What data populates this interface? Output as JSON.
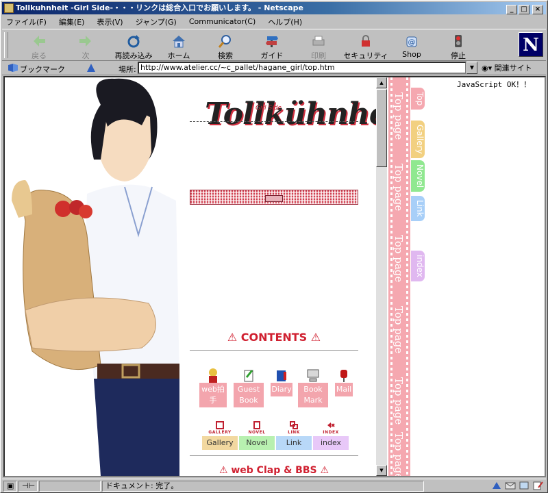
{
  "window": {
    "title": "Tollkuhnheit -Girl Side-・・・リンクは総合入口でお願いします。 - Netscape",
    "minimize": "_",
    "maximize": "□",
    "close": "×"
  },
  "menu": [
    "ファイル(F)",
    "編集(E)",
    "表示(V)",
    "ジャンプ(G)",
    "Communicator(C)",
    "ヘルプ(H)"
  ],
  "toolbar": {
    "back": "戻る",
    "forward": "次",
    "reload": "再読み込み",
    "home": "ホーム",
    "search": "検索",
    "guide": "ガイド",
    "print": "印刷",
    "security": "セキュリティ",
    "shop": "Shop",
    "stop": "停止",
    "logo": "N"
  },
  "location": {
    "bookmarks": "ブックマーク",
    "label": "場所:",
    "url": "http://www.atelier.cc/~c_pallet/hagane_girl/top.htm",
    "related": "関連サイト"
  },
  "page": {
    "logo_text": "Tollkühnheit",
    "logo_sub": "Girl Side",
    "contents_heading": "⚠ CONTENTS ⚠",
    "menu_items": [
      {
        "label": "web拍手",
        "icon": "edward-icon"
      },
      {
        "label": "Guest Book",
        "icon": "pen-icon"
      },
      {
        "label": "Diary",
        "icon": "book-icon"
      },
      {
        "label": "Book Mark",
        "icon": "computer-icon"
      },
      {
        "label": "Mail",
        "icon": "mailbox-icon"
      }
    ],
    "categories": [
      {
        "title": "GALLERY",
        "label": "Gallery",
        "color": "#f2d8a0"
      },
      {
        "title": "NOVEL",
        "label": "Novel",
        "color": "#b8f0b0"
      },
      {
        "title": "LINK",
        "label": "Link",
        "color": "#b8d8f8"
      },
      {
        "title": "INDEX",
        "label": "index",
        "color": "#e8c8f8"
      }
    ],
    "clap_heading": "⚠ web Clap & BBS ⚠"
  },
  "side": {
    "js_status": "JavaScript OK！！",
    "ribbon_label": "Top page",
    "tabs": [
      {
        "label": "Top",
        "color": "#f5a8b0"
      },
      {
        "label": "Gallery",
        "color": "#f2d080"
      },
      {
        "label": "Novel",
        "color": "#90e890"
      },
      {
        "label": "Link",
        "color": "#a8cff8"
      },
      {
        "label": "index",
        "color": "#e0b8f0"
      }
    ]
  },
  "status": {
    "text": "ドキュメント: 完了。"
  }
}
